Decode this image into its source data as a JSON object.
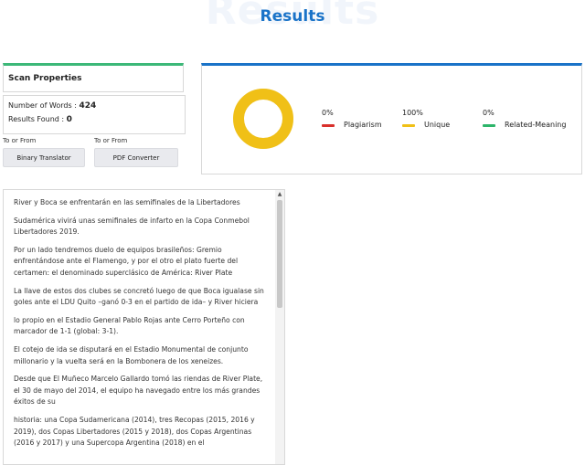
{
  "header": {
    "watermark": "Results",
    "title": "Results"
  },
  "scan_properties": {
    "title": "Scan Properties",
    "words_label": "Number of Words :",
    "words_value": "424",
    "results_label": "Results Found :",
    "results_value": "0"
  },
  "tools": [
    {
      "caption": "To or From",
      "label": "Binary Translator"
    },
    {
      "caption": "To or From",
      "label": "PDF Converter"
    }
  ],
  "result": {
    "unique_fraction": 1.0,
    "donut_color": "#f0c017",
    "metrics": [
      {
        "percent": "0%",
        "label": "Plagiarism",
        "color": "#d9302b"
      },
      {
        "percent": "100%",
        "label": "Unique",
        "color": "#f0c017"
      },
      {
        "percent": "0%",
        "label": "Related-Meaning",
        "color": "#2db56a"
      }
    ]
  },
  "content": {
    "paragraphs": [
      "River y Boca se enfrentarán en las semifinales de la Libertadores",
      "Sudamérica vivirá unas semifinales de infarto en la Copa Conmebol Libertadores 2019.",
      "Por un lado tendremos duelo de equipos brasileños: Gremio enfrentándose ante el Flamengo, y por el otro el plato fuerte del certamen: el denominado superclásico de América: River Plate",
      "La llave de estos dos clubes se concretó luego de que Boca igualase sin goles ante el LDU Quito –ganó 0-3 en el partido de ida– y River hiciera",
      "lo propio en el Estadio General Pablo Rojas ante Cerro Porteño con marcador de 1-1 (global: 3-1).",
      "El cotejo de ida se disputará en el Estadio Monumental de conjunto millonario y la vuelta será en la Bombonera de los xeneizes.",
      "Desde que El Muñeco Marcelo Gallardo tomó las riendas de River Plate, el 30 de mayo del 2014, el equipo ha navegado entre los más grandes éxitos de su",
      "historia: una Copa Sudamericana (2014), tres Recopas (2015, 2016 y 2019), dos Copas Libertadores (2015 y 2018), dos Copas Argentinas (2016 y 2017) y una Supercopa Argentina (2018) en el"
    ]
  }
}
